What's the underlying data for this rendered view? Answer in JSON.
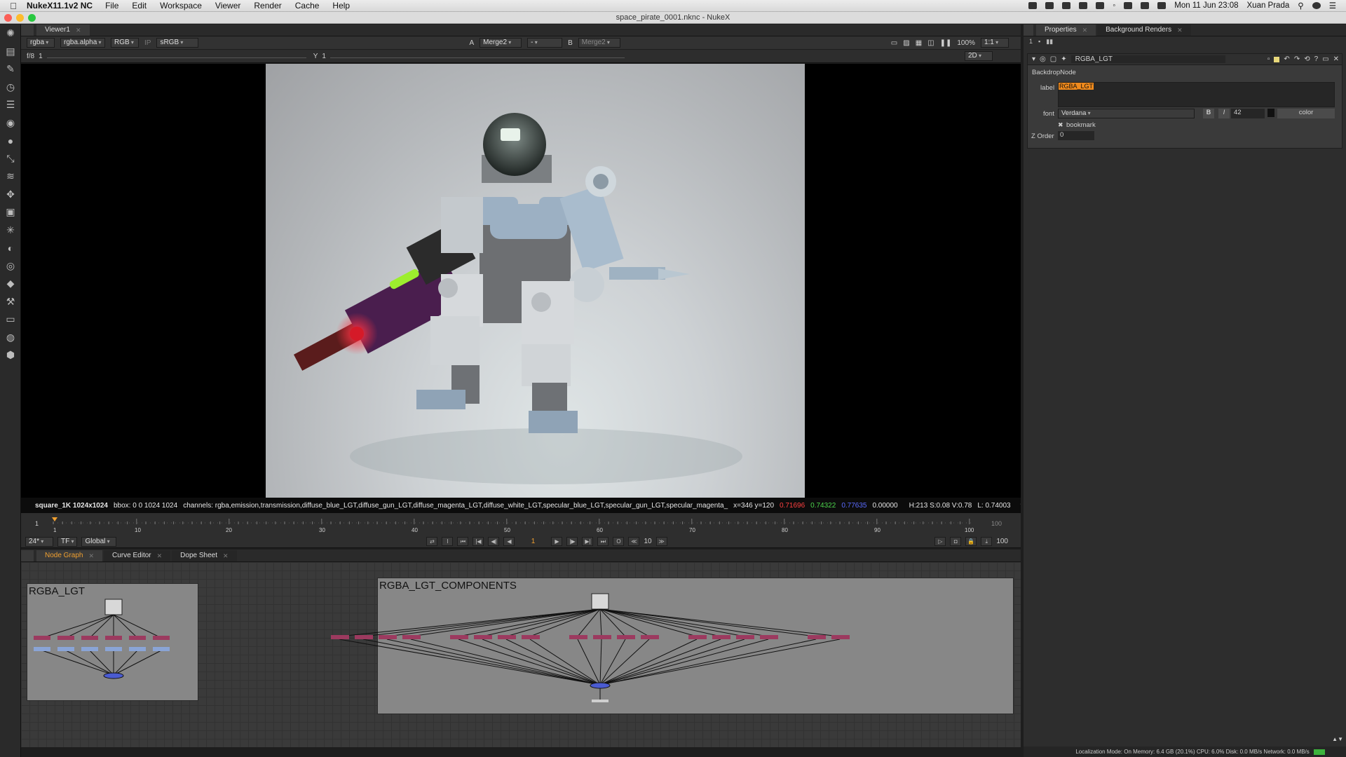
{
  "menubar": {
    "app_name": "NukeX11.1v2 NC",
    "items": [
      "File",
      "Edit",
      "Workspace",
      "Viewer",
      "Render",
      "Cache",
      "Help"
    ],
    "datetime": "Mon 11 Jun  23:08",
    "user": "Xuan Prada"
  },
  "window": {
    "title": "space_pirate_0001.nknc - NukeX"
  },
  "toolbar": {
    "icons": [
      "nuke-logo-icon",
      "image-icon",
      "draw-icon",
      "time-icon",
      "channel-icon",
      "color-icon",
      "filter-icon",
      "keyer-icon",
      "merge-icon",
      "transform-icon",
      "3d-icon",
      "particles-icon",
      "deep-icon",
      "views-icon",
      "metadata-icon",
      "toolsets-icon",
      "other-icon",
      "furnace-icon",
      "ofx-icon"
    ]
  },
  "viewer": {
    "tab": "Viewer1",
    "channels": "rgba",
    "alpha": "rgba.alpha",
    "display": "RGB",
    "colorspace": "sRGB",
    "input_a_label": "A",
    "input_a": "Merge2",
    "input_a_op": "-",
    "input_b_label": "B",
    "input_b": "Merge2",
    "fstop": "f/8",
    "frame_field": "1",
    "y_label": "Y",
    "y_value": "1",
    "zoom": "100%",
    "ratio": "1:1",
    "mode": "2D",
    "info": {
      "format": "square_1K 1024x1024",
      "bbox": "bbox: 0 0 1024 1024",
      "channels": "channels: rgba,emission,transmission,diffuse_blue_LGT,diffuse_gun_LGT,diffuse_magenta_LGT,diffuse_white_LGT,specular_blue_LGT,specular_gun_LGT,specular_magenta_",
      "coords": "x=346 y=120",
      "r": "0.71696",
      "g": "0.74322",
      "b": "0.77635",
      "a": "0.00000",
      "hsv": "H:213 S:0.08 V:0.78",
      "l": "L: 0.74003"
    }
  },
  "timeline": {
    "start": "1",
    "end": "100",
    "ticks": [
      "1",
      "10",
      "20",
      "30",
      "40",
      "50",
      "60",
      "70",
      "80",
      "90",
      "100"
    ],
    "current_frame": "1",
    "fps": "24*",
    "tf": "TF",
    "range": "Global",
    "increment": "10",
    "out_frame": "100",
    "colors": {
      "playhead": "#f0a030"
    }
  },
  "node_graph": {
    "tabs": [
      "Node Graph",
      "Curve Editor",
      "Dope Sheet"
    ],
    "backdrops": [
      {
        "label": "RGBA_LGT"
      },
      {
        "label": "RGBA_LGT_COMPONENTS"
      }
    ],
    "colors": {
      "backdrop": "#878787",
      "shuffle": "#9c3a5f",
      "grade": "#8aa4d6",
      "merge": "#4a5bd1"
    }
  },
  "properties": {
    "tabs": [
      "Properties",
      "Background Renders"
    ],
    "header_count": "1",
    "node_name": "RGBA_LGT",
    "node_class": "BackdropNode",
    "label_knob": "label",
    "label_value": "RGBA_LGT",
    "font_knob": "font",
    "font_value": "Verdana",
    "font_size": "42",
    "bold": "B",
    "italic": "I",
    "color_button": "color",
    "bookmark": "bookmark",
    "z_order_label": "Z Order",
    "z_order": "0",
    "colors": {
      "label_highlight": "#f08a1c"
    }
  },
  "statusbar": {
    "text": "Localization Mode: On  Memory: 6.4 GB (20.1%)  CPU: 6.0%  Disk: 0.0 MB/s  Network: 0.0 MB/s"
  }
}
